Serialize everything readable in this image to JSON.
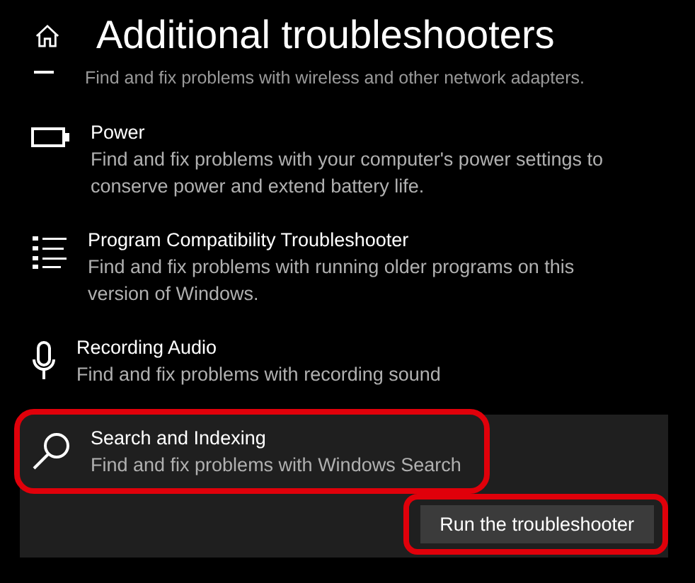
{
  "page": {
    "title": "Additional troubleshooters"
  },
  "troubleshooters": [
    {
      "kind": "network",
      "description": "Find and fix problems with wireless and other network adapters.",
      "selected": false
    },
    {
      "kind": "power",
      "title": "Power",
      "description": "Find and fix problems with your computer's power settings to conserve power and extend battery life.",
      "selected": false
    },
    {
      "kind": "compatibility",
      "title": "Program Compatibility Troubleshooter",
      "description": "Find and fix problems with running older programs on this version of Windows.",
      "selected": false
    },
    {
      "kind": "audio",
      "title": "Recording Audio",
      "description": "Find and fix problems with recording sound",
      "selected": false
    },
    {
      "kind": "search",
      "title": "Search and Indexing",
      "description": "Find and fix problems with Windows Search",
      "selected": true,
      "highlighted": true,
      "button": {
        "label": "Run the troubleshooter",
        "highlighted": true
      }
    }
  ]
}
